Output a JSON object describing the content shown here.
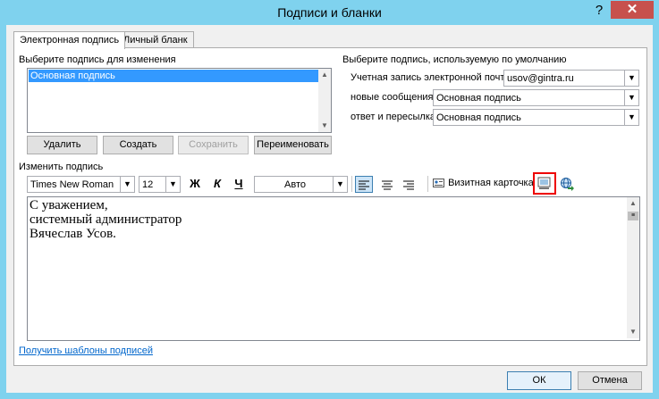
{
  "window": {
    "title": "Подписи и бланки",
    "help": "?",
    "close": "✕"
  },
  "tabs": [
    {
      "label": "Электронная подпись"
    },
    {
      "label": "Личный бланк"
    }
  ],
  "select_section": {
    "label": "Выберите подпись для изменения",
    "items": [
      "Основная подпись"
    ],
    "buttons": {
      "delete": "Удалить",
      "create": "Создать",
      "save": "Сохранить",
      "rename": "Переименовать"
    }
  },
  "defaults": {
    "label": "Выберите подпись, используемую по умолчанию",
    "account_label": "Учетная запись электронной почты:",
    "account_value": "usov@gintra.ru",
    "new_messages_label": "новые сообщения:",
    "new_messages_value": "Основная подпись",
    "reply_label": "ответ и пересылка:",
    "reply_value": "Основная подпись"
  },
  "edit": {
    "label": "Изменить подпись",
    "font": "Times New Roman",
    "size": "12",
    "bold": "Ж",
    "italic": "К",
    "underline": "Ч",
    "color": "Авто",
    "business_card": "Визитная карточка",
    "lines": [
      "С уважением,",
      "системный администратор",
      "Вячеслав Усов."
    ]
  },
  "footer": {
    "templates_link": "Получить шаблоны подписей",
    "ok": "ОК",
    "cancel": "Отмена"
  }
}
